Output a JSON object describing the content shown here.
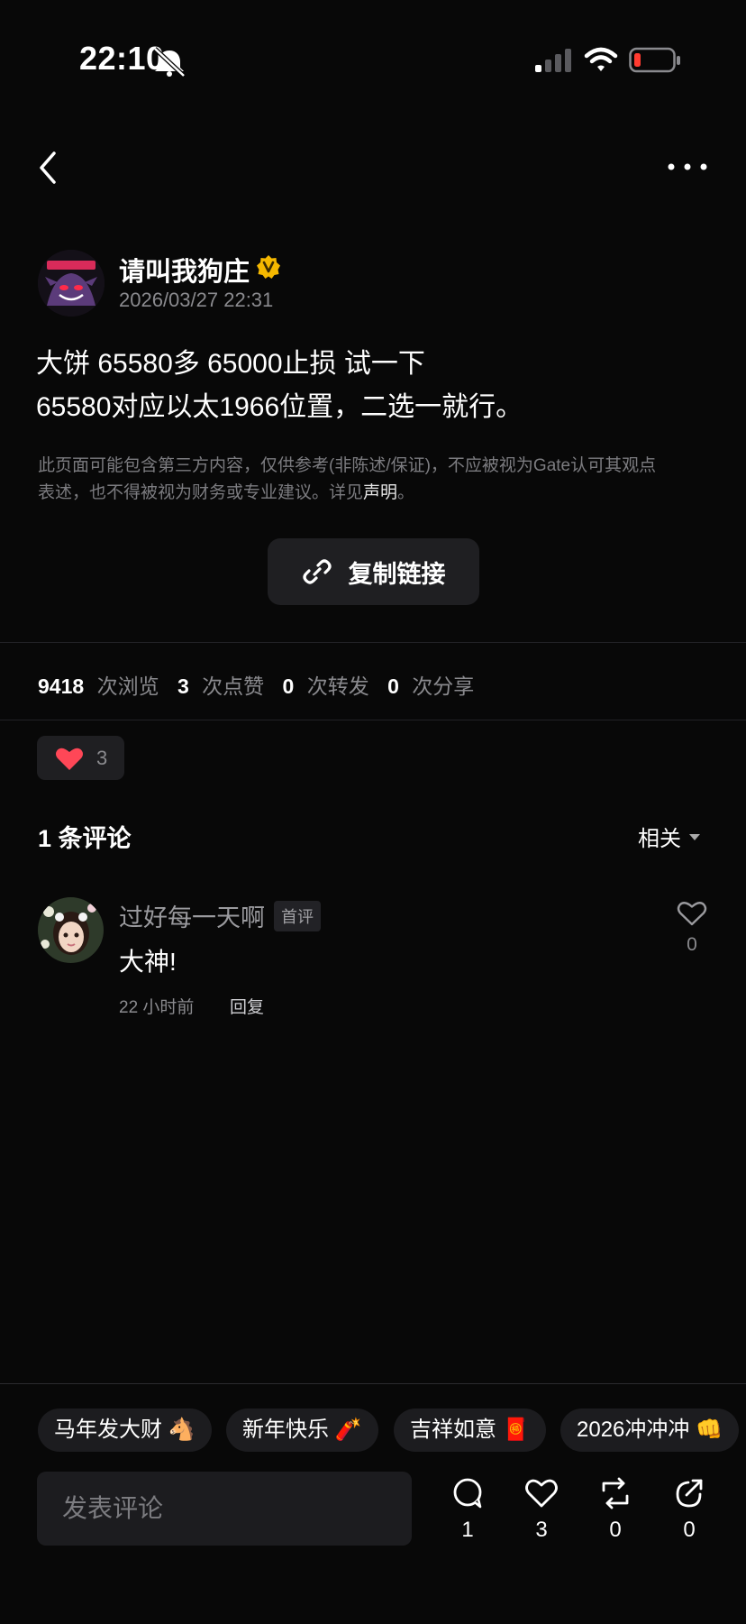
{
  "status_bar": {
    "time": "22:10"
  },
  "post": {
    "author": "请叫我狗庄",
    "timestamp": "2026/03/27 22:31",
    "line1": "大饼 65580多 65000止损 试一下",
    "line2": "65580对应以太1966位置，二选一就行。",
    "disclaimer_line1": "此页面可能包含第三方内容，仅供参考(非陈述/保证)，不应被视为Gate认可其观点",
    "disclaimer_line2_prefix": "表述，也不得被视为财务或专业建议。详见",
    "disclaimer_link": "声明",
    "disclaimer_end": "。",
    "copy_link_label": "复制链接"
  },
  "stats": {
    "views": "9418",
    "views_label": "次浏览",
    "likes": "3",
    "likes_label": "次点赞",
    "reposts": "0",
    "reposts_label": "次转发",
    "shares": "0",
    "shares_label": "次分享"
  },
  "reaction": {
    "count": "3",
    "color": "#ff4757"
  },
  "comments": {
    "header": "1 条评论",
    "sort_label": "相关",
    "items": [
      {
        "author": "过好每一天啊",
        "badge": "首评",
        "text": "大神!",
        "time": "22 小时前",
        "reply_label": "回复",
        "likes": "0"
      }
    ]
  },
  "quick_tags": [
    "马年发大财 🐴",
    "新年快乐 🧨",
    "吉祥如意 🧧",
    "2026冲冲冲 👊"
  ],
  "bottom_bar": {
    "comment_placeholder": "发表评论",
    "comment_count": "1",
    "like_count": "3",
    "repost_count": "0",
    "share_count": "0"
  },
  "colors": {
    "background": "#080808",
    "verified_badge": "#f5b800",
    "muted_text": "#8a8a8e"
  }
}
